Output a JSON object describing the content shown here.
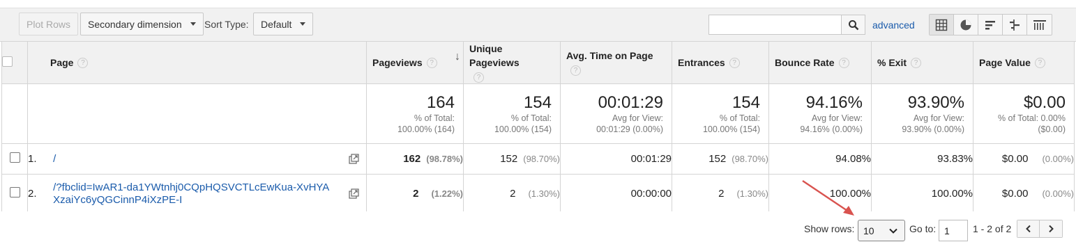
{
  "toolbar": {
    "plot_rows": "Plot Rows",
    "secondary_dimension": "Secondary dimension",
    "sort_type_label": "Sort Type:",
    "sort_type_value": "Default",
    "search_placeholder": "",
    "advanced": "advanced",
    "view_icons": [
      "table-view-icon",
      "pie-view-icon",
      "performance-view-icon",
      "comparison-view-icon",
      "pivot-view-icon"
    ]
  },
  "table": {
    "headers": {
      "page": "Page",
      "pageviews": "Pageviews",
      "unique_pageviews": "Unique Pageviews",
      "avg_time": "Avg. Time on Page",
      "entrances": "Entrances",
      "bounce_rate": "Bounce Rate",
      "exit": "% Exit",
      "page_value": "Page Value"
    },
    "totals": {
      "pageviews": {
        "value": "164",
        "sub1": "% of Total:",
        "sub2": "100.00% (164)"
      },
      "unique_pageviews": {
        "value": "154",
        "sub1": "% of Total:",
        "sub2": "100.00% (154)"
      },
      "avg_time": {
        "value": "00:01:29",
        "sub1": "Avg for View:",
        "sub2": "00:01:29 (0.00%)"
      },
      "entrances": {
        "value": "154",
        "sub1": "% of Total:",
        "sub2": "100.00% (154)"
      },
      "bounce_rate": {
        "value": "94.16%",
        "sub1": "Avg for View:",
        "sub2": "94.16% (0.00%)"
      },
      "exit": {
        "value": "93.90%",
        "sub1": "Avg for View:",
        "sub2": "93.90% (0.00%)"
      },
      "page_value": {
        "value": "$0.00",
        "sub1": "% of Total: 0.00%",
        "sub2": "($0.00)"
      }
    },
    "rows": [
      {
        "rank": "1.",
        "page": "/",
        "pageviews": "162",
        "pageviews_pct": "(98.78%)",
        "unique": "152",
        "unique_pct": "(98.70%)",
        "avg_time": "00:01:29",
        "entrances": "152",
        "entrances_pct": "(98.70%)",
        "bounce": "94.08%",
        "exit": "93.83%",
        "value": "$0.00",
        "value_pct": "(0.00%)"
      },
      {
        "rank": "2.",
        "page": "/?fbclid=IwAR1-da1YWtnhj0CQpHQSVCTLcEwKua-XvHYAXzaiYc6yQGCinnP4iXzPE-I",
        "pageviews": "2",
        "pageviews_pct": "(1.22%)",
        "unique": "2",
        "unique_pct": "(1.30%)",
        "avg_time": "00:00:00",
        "entrances": "2",
        "entrances_pct": "(1.30%)",
        "bounce": "100.00%",
        "exit": "100.00%",
        "value": "$0.00",
        "value_pct": "(0.00%)"
      }
    ]
  },
  "footer": {
    "show_rows_label": "Show rows:",
    "show_rows_value": "10",
    "goto_label": "Go to:",
    "goto_value": "1",
    "range": "1 - 2 of 2"
  },
  "colors": {
    "link": "#1a5bab",
    "annotation_arrow": "#d9534f"
  }
}
